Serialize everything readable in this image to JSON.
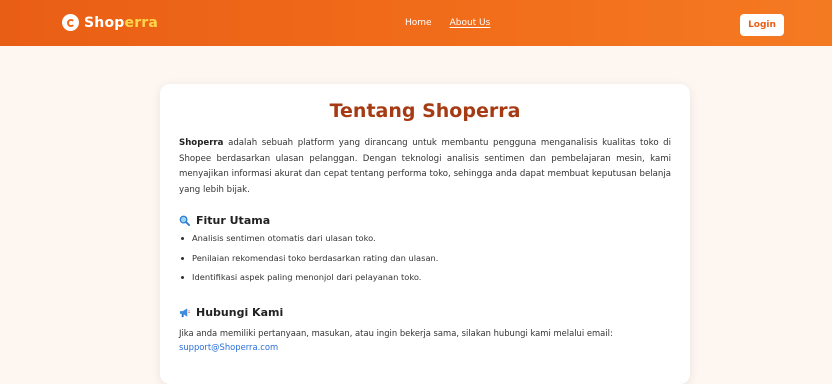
{
  "navbar": {
    "brand_part1": "Shop",
    "brand_part2": "erra",
    "links": [
      {
        "label": "Home"
      },
      {
        "label": "About Us"
      }
    ],
    "login_label": "Login",
    "colors": {
      "bar": "#ee6a1c",
      "accent": "#ffd54a"
    }
  },
  "content": {
    "title": "Tentang Shoperra",
    "intro_bold": "Shoperra",
    "intro_rest": "adalah sebuah platform yang dirancang untuk membantu pengguna menganalisis kualitas toko di Shopee berdasarkan ulasan pelanggan. Dengan teknologi analisis sentimen dan pembelajaran mesin, kami menyajikan informasi akurat dan cepat tentang performa toko, sehingga anda dapat membuat keputusan belanja yang lebih bijak.",
    "features_heading": "Fitur Utama",
    "features_icon": "magnifier-icon",
    "features": [
      "Analisis sentimen otomatis dari ulasan toko.",
      "Penilaian rekomendasi toko berdasarkan rating dan ulasan.",
      "Identifikasi aspek paling menonjol dari pelayanan toko."
    ],
    "contact_heading": "Hubungi Kami",
    "contact_icon": "megaphone-icon",
    "contact_text": "Jika anda memiliki pertanyaan, masukan, atau ingin bekerja sama, silakan hubungi kami melalui email:",
    "contact_email": "support@Shoperra.com"
  }
}
